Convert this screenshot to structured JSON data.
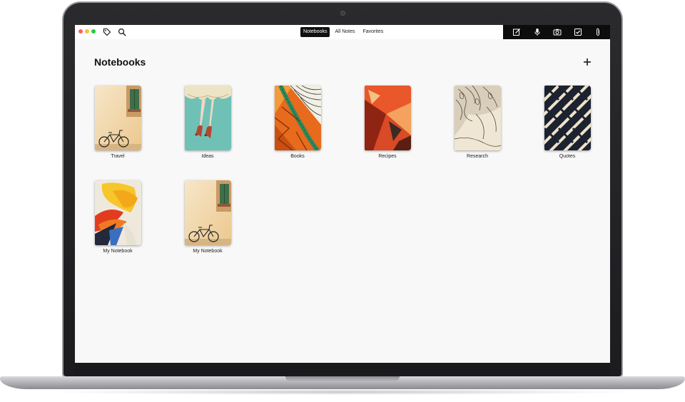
{
  "toolbar": {
    "tabs": [
      {
        "label": "Notebooks",
        "active": true
      },
      {
        "label": "All Notes",
        "active": false
      },
      {
        "label": "Favorites",
        "active": false
      }
    ],
    "left_icons": [
      "tag-icon",
      "search-icon"
    ],
    "action_icons": [
      "compose-icon",
      "microphone-icon",
      "camera-icon",
      "checklist-icon",
      "paperclip-icon"
    ]
  },
  "main": {
    "title": "Notebooks",
    "add_icon": "plus-icon",
    "notebooks": [
      {
        "label": "Travel",
        "cover": "bicycle-wall"
      },
      {
        "label": "Ideas",
        "cover": "ballerina"
      },
      {
        "label": "Books",
        "cover": "orange-pattern"
      },
      {
        "label": "Recipes",
        "cover": "red-abstract"
      },
      {
        "label": "Research",
        "cover": "ink-drawing"
      },
      {
        "label": "Quotes",
        "cover": "geometric-weave"
      },
      {
        "label": "My Notebook",
        "cover": "paint-splash"
      },
      {
        "label": "My Notebook",
        "cover": "bicycle-wall"
      }
    ]
  },
  "colors": {
    "accent": "#111111",
    "traffic_red": "#fc6058",
    "traffic_yellow": "#fec02f",
    "traffic_green": "#2aca3e",
    "background": "#f8f8f8"
  }
}
